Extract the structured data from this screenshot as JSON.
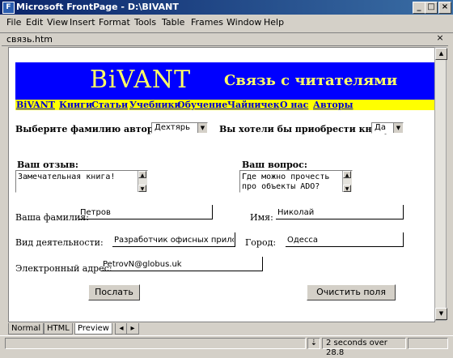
{
  "window": {
    "title": "Microsoft FrontPage - D:\\BIVANT",
    "app_icon": "frontpage-icon",
    "controls": [
      "minimize",
      "maximize",
      "close"
    ]
  },
  "menu": [
    "File",
    "Edit",
    "View",
    "Insert",
    "Format",
    "Tools",
    "Table",
    "Frames",
    "Window",
    "Help"
  ],
  "file_tab": {
    "name": "связь.htm"
  },
  "page": {
    "banner": {
      "logo": "BiVANT",
      "title": "Связь с читателями",
      "bg_color": "#0000ff",
      "text_color": "#ffff66"
    },
    "nav": [
      "BiVANT",
      "Книги",
      "Статьи",
      "Учебники",
      "Обучение",
      "Чайничек",
      "О нас",
      "Авторы"
    ],
    "author": {
      "label": "Выберите фамилию автора:",
      "value": "Дехтярь"
    },
    "buy": {
      "label": "Вы хотели бы приобрести книгу:",
      "value": "Да"
    },
    "review": {
      "label": "Ваш отзыв:",
      "text": "Замечательная книга!"
    },
    "question": {
      "label": "Ваш вопрос:",
      "text": "Где можно прочесть\nпро объекты ADO?"
    },
    "surname": {
      "label": "Ваша фамилия:",
      "value": "Петров"
    },
    "name": {
      "label": "Имя:",
      "value": "Николай"
    },
    "occupation": {
      "label": "Вид деятельности:",
      "value": "Разработчик офисных прилож"
    },
    "city": {
      "label": "Город:",
      "value": "Одесса"
    },
    "email": {
      "label": "Электронный адрес:",
      "value": "PetrovN@globus.uk"
    },
    "submit_label": "Послать",
    "reset_label": "Очистить поля"
  },
  "view_tabs": [
    "Normal",
    "HTML",
    "Preview"
  ],
  "status": {
    "text": "2 seconds over 28.8"
  }
}
